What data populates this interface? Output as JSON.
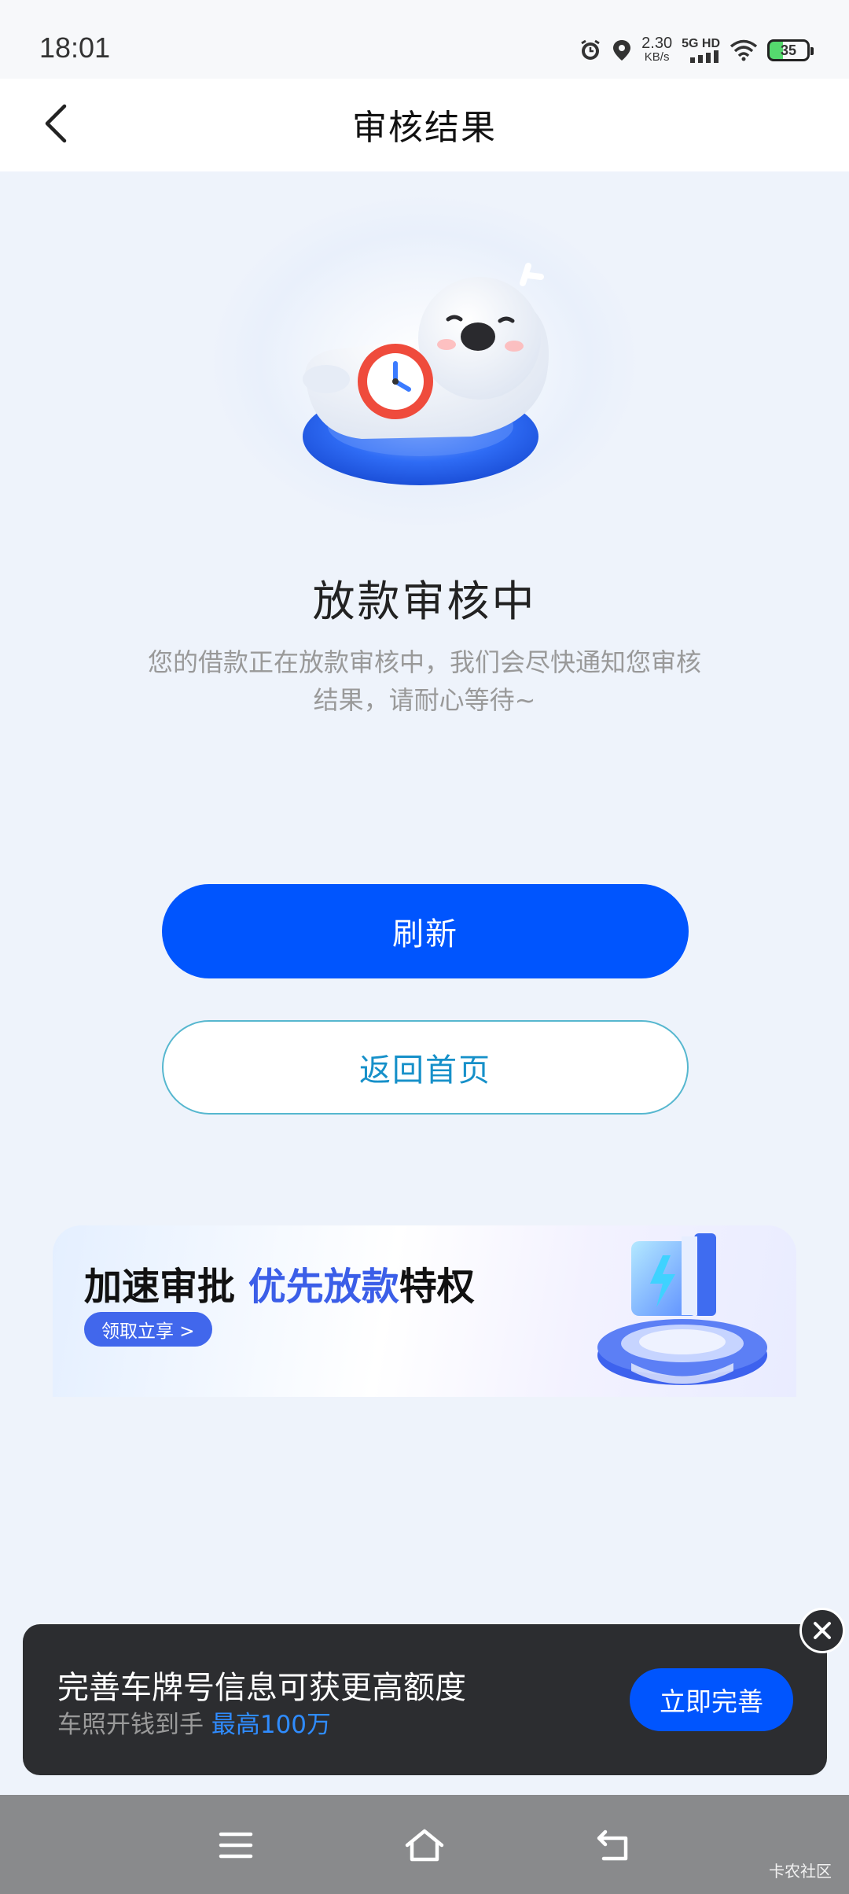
{
  "status_bar": {
    "time": "18:01",
    "speed_value": "2.30",
    "speed_unit": "KB/s",
    "network": "5G HD",
    "battery": "35"
  },
  "nav": {
    "title": "审核结果"
  },
  "review": {
    "title": "放款审核中",
    "description": "您的借款正在放款审核中，我们会尽快通知您审核结果，请耐心等待~"
  },
  "buttons": {
    "refresh": "刷新",
    "home": "返回首页"
  },
  "promo": {
    "title_part1": "加速审批 ",
    "title_highlight": "优先放款",
    "title_part2": "特权",
    "cta": "领取立享 >"
  },
  "tip": {
    "title": "完善车牌号信息可获更高额度",
    "subtitle": "车照开钱到手 ",
    "subtitle_highlight": "最高100万",
    "action": "立即完善"
  },
  "watermark": "卡农社区",
  "colors": {
    "primary": "#0055fe",
    "page_bg": "#eef3fb",
    "tip_bg": "#2c2d30",
    "highlight_blue": "#3b5ee8"
  }
}
